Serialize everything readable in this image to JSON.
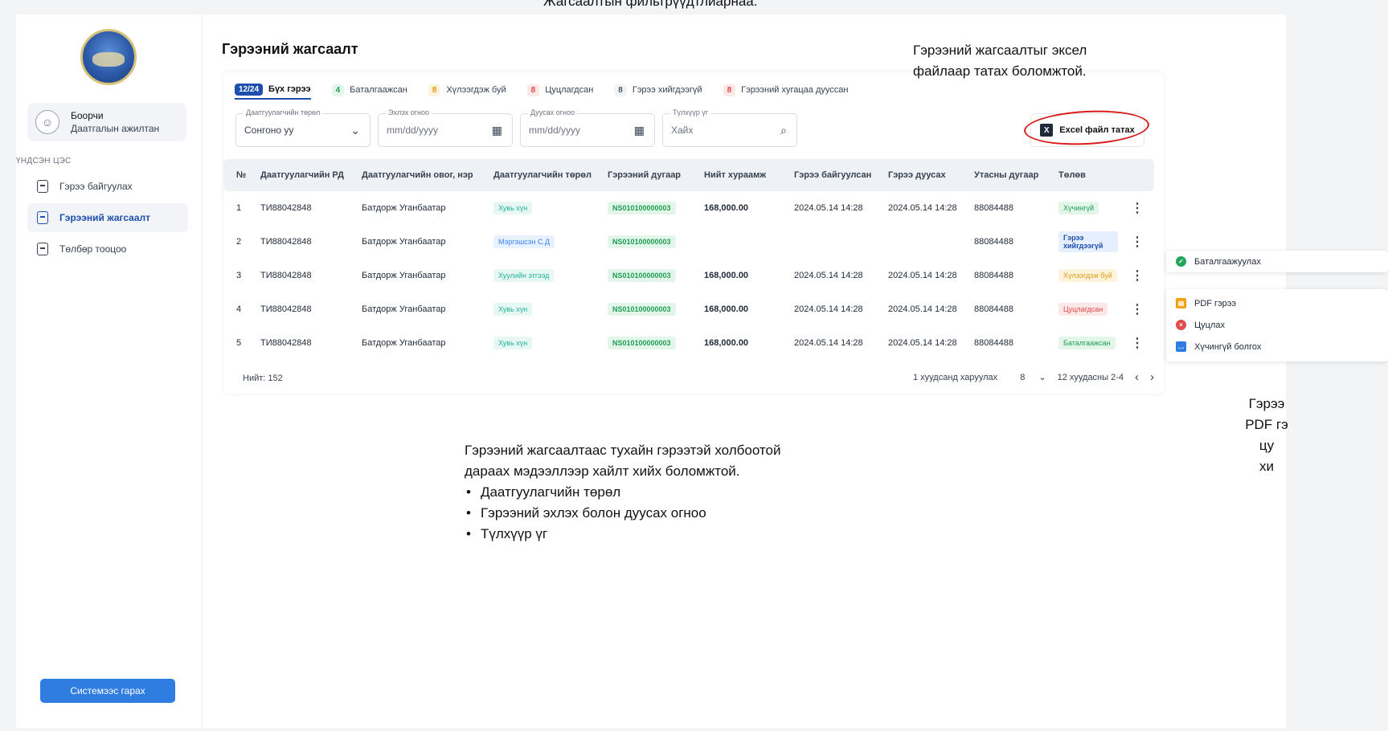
{
  "top_caption": "Жагсаалтын фильтрүүдтлиарнаа.",
  "sidebar": {
    "user_name": "Боорчи",
    "user_role": "Даатгалын ажилтан",
    "section": "ҮНДСЭН ЦЭС",
    "items": [
      {
        "label": "Гэрээ байгуулах"
      },
      {
        "label": "Гэрээний жагсаалт"
      },
      {
        "label": "Төлбөр тооцоо"
      }
    ],
    "logout": "Системээс гарах"
  },
  "page_title": "Гэрээний жагсаалт",
  "tabs": [
    {
      "badge": "12/24",
      "label": "Бүх гэрээ"
    },
    {
      "badge": "4",
      "label": "Баталгаажсан"
    },
    {
      "badge": "8",
      "label": "Хүлээгдэж буй"
    },
    {
      "badge": "8",
      "label": "Цуцлагдсан"
    },
    {
      "badge": "8",
      "label": "Гэрээ хийгдээгүй"
    },
    {
      "badge": "8",
      "label": "Гэрээний хугацаа дууссан"
    }
  ],
  "filters": {
    "type": {
      "label": "Даатгуулагчийн төрөл",
      "value": "Сонгоно уу"
    },
    "start": {
      "label": "Эхлэх огноо",
      "placeholder": "mm/dd/yyyy"
    },
    "end": {
      "label": "Дуусах огноо",
      "placeholder": "mm/dd/yyyy"
    },
    "keyword": {
      "label": "Түлхүүр үг",
      "placeholder": "Хайх"
    }
  },
  "excel_button": "Excel файл татах",
  "table": {
    "headers": [
      "№",
      "Даатгуулагчийн РД",
      "Даатгуулагчийн овог, нэр",
      "Даатгуулагчийн төрөл",
      "Гэрээний дугаар",
      "Нийт хураамж",
      "Гэрээ байгуулсан",
      "Гэрээ дуусах",
      "Утасны дугаар",
      "Төлөв"
    ],
    "rows": [
      {
        "n": "1",
        "rd": "ТИ88042848",
        "name": "Батдорж Уганбаатар",
        "type": "Хувь хүн",
        "code": "NS010100000003",
        "fee": "168,000.00",
        "start": "2024.05.14 14:28",
        "end": "2024.05.14 14:28",
        "phone": "88084488",
        "status": "Хүчингүй"
      },
      {
        "n": "2",
        "rd": "ТИ88042848",
        "name": "Батдорж Уганбаатар",
        "type": "Мэргэшсэн С.Д",
        "code": "NS010100000003",
        "fee": "",
        "start": "",
        "end": "",
        "phone": "88084488",
        "status": "Гэрээ хийгдээгүй"
      },
      {
        "n": "3",
        "rd": "ТИ88042848",
        "name": "Батдорж Уганбаатар",
        "type": "Хуулийн этгээд",
        "code": "NS010100000003",
        "fee": "168,000.00",
        "start": "2024.05.14 14:28",
        "end": "2024.05.14 14:28",
        "phone": "88084488",
        "status": "Хүлээгдэж буй"
      },
      {
        "n": "4",
        "rd": "ТИ88042848",
        "name": "Батдорж Уганбаатар",
        "type": "Хувь хүн",
        "code": "NS010100000003",
        "fee": "168,000.00",
        "start": "2024.05.14 14:28",
        "end": "2024.05.14 14:28",
        "phone": "88084488",
        "status": "Цуцлагдсан"
      },
      {
        "n": "5",
        "rd": "ТИ88042848",
        "name": "Батдорж Уганбаатар",
        "type": "Хувь хүн",
        "code": "NS010100000003",
        "fee": "168,000.00",
        "start": "2024.05.14 14:28",
        "end": "2024.05.14 14:28",
        "phone": "88084488",
        "status": "Баталгаажсан"
      }
    ]
  },
  "footer": {
    "total": "Нийт: 152",
    "per_page_label": "1 хуудсанд харуулах",
    "per_page": "8",
    "range": "12 хуудасны 2-4"
  },
  "annotations": {
    "excel_note": [
      "Гэрээний жагсаалтыг эксел",
      "файлаар татах боломжтой."
    ],
    "search_note": [
      "Гэрээний жагсаалтаас тухайн гэрээтэй холбоотой",
      "дараах мэдээллээр хайлт хийх боломжтой."
    ],
    "search_items": [
      "Даатгуулагчийн төрөл",
      "Гэрээний эхлэх болон дуусах огноо",
      "Түлхүүр үг"
    ],
    "right_note": [
      "Гэрээ",
      "PDF гэ",
      "цу",
      "хи"
    ]
  },
  "context_menu": {
    "confirm": "Баталгаажуулах",
    "items": [
      "PDF гэрээ",
      "Цуцлах",
      "Хүчингүй болгох"
    ]
  },
  "colors": {
    "primary": "#1e4fae",
    "button": "#2f7de1",
    "highlight_ring": "#d91c1c"
  }
}
